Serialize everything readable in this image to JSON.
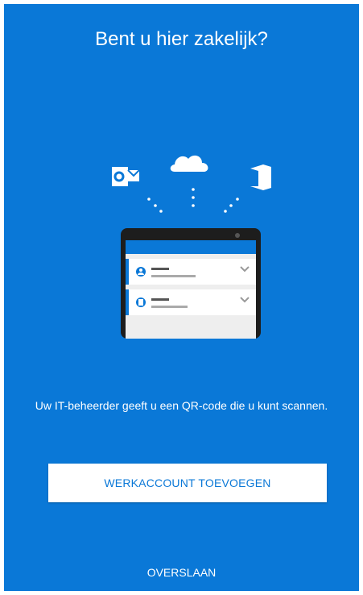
{
  "screen": {
    "title": "Bent u hier zakelijk?",
    "subtitle": "Uw IT-beheerder geeft u een QR-code die u kunt scannen.",
    "primary_button": "WERKACCOUNT TOEVOEGEN",
    "skip_button": "OVERSLAAN"
  },
  "colors": {
    "background": "#0a78d7",
    "button_text": "#0a78d7",
    "button_background": "#ffffff"
  },
  "illustration": {
    "icons": [
      "outlook-icon",
      "onedrive-cloud-icon",
      "office-icon"
    ],
    "list_icons": [
      "user-icon",
      "badge-icon"
    ]
  }
}
